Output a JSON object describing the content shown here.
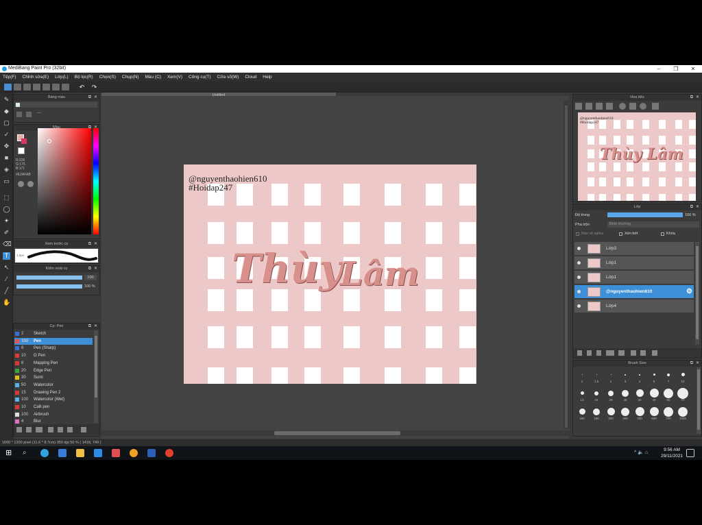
{
  "window": {
    "title": "MediBang Paint Pro (32bit)",
    "min": "–",
    "max": "❐",
    "close": "✕"
  },
  "menu": [
    "Tệp(F)",
    "Chỉnh sửa(E)",
    "Lớp(L)",
    "Bộ lọc(R)",
    "Chọn(S)",
    "Chụp(N)",
    "Màu (C)",
    "Xem(V)",
    "Công cụ(T)",
    "Cửa số(W)",
    "Cloud",
    "Help"
  ],
  "toolbar": {
    "undo": "↶",
    "redo": "↷"
  },
  "panels": {
    "swatch": {
      "title": "Bảng màu",
      "dash": "---"
    },
    "color": {
      "title": "Màu",
      "r": "R:226",
      "g": "G:175",
      "b": "B:171",
      "hex": "#E2AFAB"
    },
    "brush_preview": {
      "title": "Xem trước cọ",
      "size": "1.2px"
    },
    "brush_control": {
      "title": "Kiểm soát cọ",
      "size_val": "100",
      "opacity_val": "100 %"
    },
    "brushes": {
      "title": "Cọ: Pen",
      "items": [
        {
          "num": "2",
          "name": "Sketch",
          "color": "#3a6fd0"
        },
        {
          "num": "100",
          "name": "Pen",
          "color": "#e05555"
        },
        {
          "num": "8",
          "name": "Pen (Sharp)",
          "color": "#3a6fd0"
        },
        {
          "num": "10",
          "name": "G Pen",
          "color": "#d83a3a"
        },
        {
          "num": "8",
          "name": "Mapping Pen",
          "color": "#d83a3a"
        },
        {
          "num": "20",
          "name": "Edge Pen",
          "color": "#3aa53a"
        },
        {
          "num": "30",
          "name": "Sumi",
          "color": "#e0c020"
        },
        {
          "num": "50",
          "name": "Watercolor",
          "color": "#5ab0e0"
        },
        {
          "num": "15",
          "name": "Drawing Pen 2",
          "color": "#d83a3a"
        },
        {
          "num": "100",
          "name": "Watercolor (Wet)",
          "color": "#5ab0e0"
        },
        {
          "num": "10",
          "name": "Calli pen",
          "color": "#d83a3a"
        },
        {
          "num": "100",
          "name": "Airbrush",
          "color": "#dddddd"
        },
        {
          "num": "4",
          "name": "Blur",
          "color": "#e070c0"
        }
      ]
    },
    "navigator": {
      "title": "Hoa tiêu"
    },
    "layers": {
      "title": "Lớp",
      "opacity_label": "Độ trong",
      "opacity_val": "100 %",
      "blend_label": "Pha trộn",
      "blend_val": "Bình thường",
      "alpha": "Bảo vệ alpha",
      "clip": "Xén bớt",
      "lock": "Khóa",
      "items": [
        {
          "name": "Lớp3"
        },
        {
          "name": "Lớp1"
        },
        {
          "name": "Lớp1"
        },
        {
          "name": "@nguyenthaohien610"
        },
        {
          "name": "Lớp4"
        }
      ]
    },
    "brush_size": {
      "title": "Brush Size",
      "rows": [
        [
          "1",
          "1.5",
          "2",
          "3",
          "4",
          "5",
          "7",
          "10"
        ],
        [
          "13",
          "15",
          "20",
          "25",
          "30",
          "40",
          "50",
          "70"
        ],
        [
          "100",
          "150",
          "200",
          "300",
          "400",
          "500",
          "700",
          "1000"
        ]
      ]
    }
  },
  "document": {
    "tab": "Untitled",
    "watermark_line1": "@nguyenthaohien610",
    "watermark_line2": "#Hoidap247",
    "hand_word1": "Thùy",
    "hand_word2": "Lâm",
    "nav_hand": "Thùy Lâm"
  },
  "status": "1600 * 1200 pixel   (11.6 * 8.7cm)   350 dpi   50 %   ( 1418, 749 )",
  "clock": {
    "time": "9:56 AM",
    "date": "29/11/2021"
  },
  "tray": "^  🔈  ⌂"
}
